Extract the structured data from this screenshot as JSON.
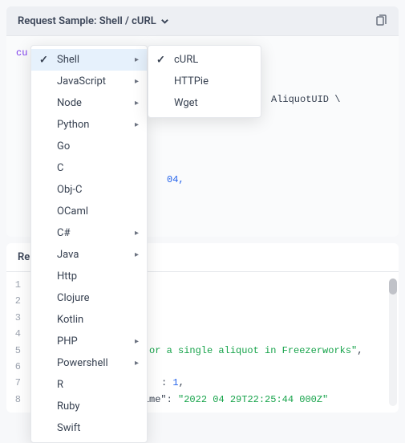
{
  "header": {
    "label": "Request Sample: Shell / cURL"
  },
  "code": {
    "keyword": "cu",
    "path_fragment": "AliquotUID  \\",
    "literal": "04,",
    "brace": "}'"
  },
  "menu": {
    "items": [
      {
        "label": "Shell",
        "has_sub": true,
        "selected": true
      },
      {
        "label": "JavaScript",
        "has_sub": true
      },
      {
        "label": "Node",
        "has_sub": true
      },
      {
        "label": "Python",
        "has_sub": true
      },
      {
        "label": "Go"
      },
      {
        "label": "C"
      },
      {
        "label": "Obj-C"
      },
      {
        "label": "OCaml"
      },
      {
        "label": "C#",
        "has_sub": true
      },
      {
        "label": "Java",
        "has_sub": true
      },
      {
        "label": "Http"
      },
      {
        "label": "Clojure"
      },
      {
        "label": "Kotlin"
      },
      {
        "label": "PHP",
        "has_sub": true
      },
      {
        "label": "Powershell",
        "has_sub": true
      },
      {
        "label": "R"
      },
      {
        "label": "Ruby"
      },
      {
        "label": "Swift"
      }
    ],
    "submenu": [
      {
        "label": "cURL",
        "selected": true
      },
      {
        "label": "HTTPie"
      },
      {
        "label": "Wget"
      }
    ]
  },
  "response": {
    "header": "Re",
    "lines": [
      {
        "n": "1",
        "content": ""
      },
      {
        "n": "2",
        "content": ""
      },
      {
        "n": "3",
        "content": ""
      },
      {
        "n": "4",
        "content": ""
      },
      {
        "n": "5",
        "frag": "or a single aliquot in Freezerworks\""
      },
      {
        "n": "6",
        "content": ""
      },
      {
        "n": "7",
        "num": "1"
      },
      {
        "n": "8",
        "key": "\"creationDateTime\"",
        "val": "\"2022 04 29T22:25:44 000Z\""
      }
    ]
  }
}
